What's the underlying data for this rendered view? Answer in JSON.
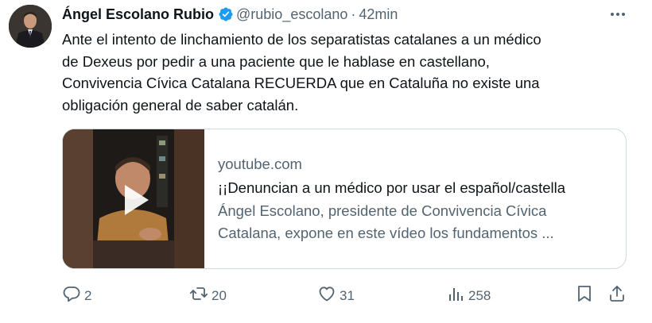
{
  "author": {
    "name": "Ángel Escolano Rubio",
    "handle": "@rubio_escolano",
    "separator": "·",
    "time": "42min"
  },
  "tweet": {
    "lines": [
      "Ante el intento de linchamiento de los separatistas catalanes a un médico",
      "de Dexeus por pedir a una paciente que le hablase en castellano,",
      "Convivencia Cívica Catalana RECUERDA que en Cataluña no existe una",
      "obligación general de saber catalán."
    ]
  },
  "card": {
    "domain": "youtube.com",
    "title": "¡¡Denuncian a un médico por usar el español/castella",
    "description_lines": [
      "Ángel Escolano, presidente de Convivencia Cívica",
      "Catalana, expone en este vídeo los fundamentos ..."
    ]
  },
  "actions": {
    "replies": "2",
    "retweets": "20",
    "likes": "31",
    "views": "258"
  },
  "colors": {
    "verified": "#1d9bf0",
    "secondary_text": "#536471",
    "primary_text": "#0f1419",
    "card_border": "#cfd9de"
  },
  "icons": [
    "more-icon",
    "verified-badge-icon",
    "reply-icon",
    "retweet-icon",
    "like-icon",
    "views-icon",
    "bookmark-icon",
    "share-icon",
    "play-icon"
  ]
}
